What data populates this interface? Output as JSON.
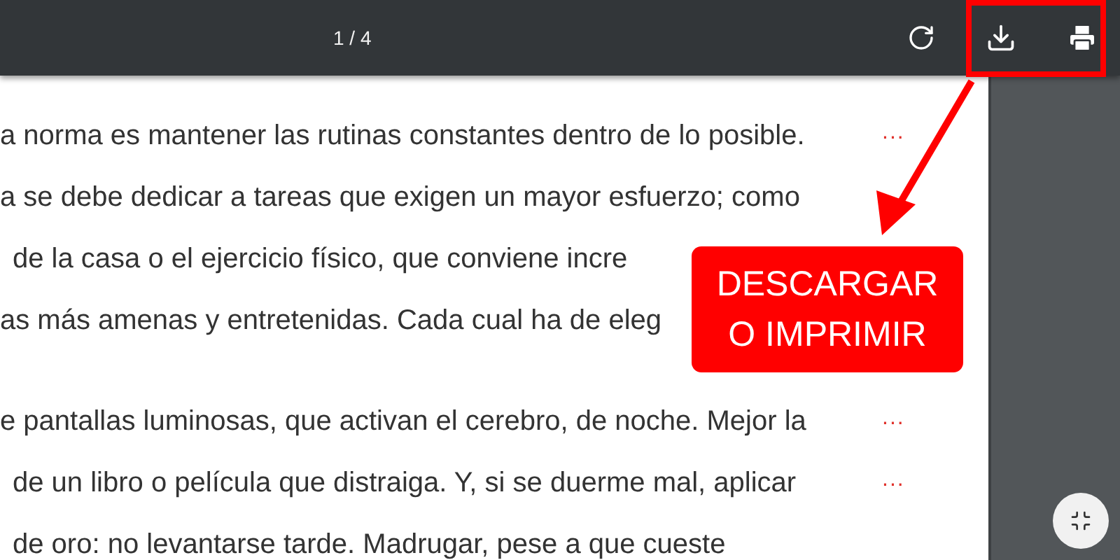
{
  "toolbar": {
    "page_indicator": "1 / 4"
  },
  "document": {
    "lines": [
      {
        "text": "a norma es mantener las rutinas constantes dentro de lo posible.",
        "indent": false,
        "marker": "..."
      },
      {
        "text": "a se debe dedicar a tareas que exigen un mayor esfuerzo; como",
        "indent": false
      },
      {
        "text": "de la casa o el ejercicio físico, que conviene incre",
        "indent": true
      },
      {
        "text": "as más amenas y entretenidas. Cada cual ha de eleg",
        "indent": false
      },
      {
        "kind": "gap"
      },
      {
        "text": "e pantallas luminosas, que activan el cerebro, de noche. Mejor la",
        "indent": false,
        "marker": "..."
      },
      {
        "text": "de un libro o película que distraiga. Y, si se duerme mal, aplicar",
        "indent": true,
        "marker": "..."
      },
      {
        "text": "de oro: no levantarse tarde. Madrugar, pese a que cueste",
        "indent": true
      }
    ]
  },
  "callout": {
    "lines": [
      "DESCARGAR",
      "O IMPRIMIR"
    ]
  }
}
